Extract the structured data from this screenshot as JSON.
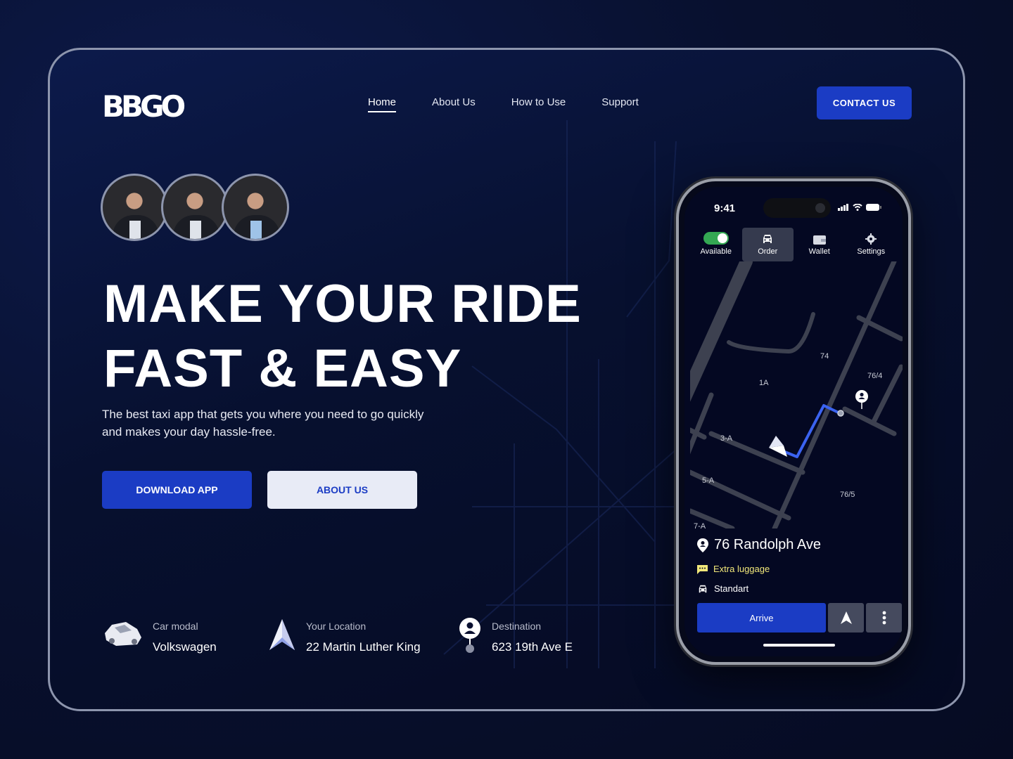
{
  "brand": {
    "logo": "BBGO"
  },
  "nav": {
    "items": [
      {
        "label": "Home",
        "active": true
      },
      {
        "label": "About Us",
        "active": false
      },
      {
        "label": "How to Use",
        "active": false
      },
      {
        "label": "Support",
        "active": false
      }
    ],
    "contact_label": "CONTACT US"
  },
  "hero": {
    "headline_line1": "MAKE YOUR RIDE",
    "headline_line2": "FAST & EASY",
    "subtitle": "The best taxi app that gets you where you need to go quickly and makes your day hassle-free.",
    "download_label": "DOWNLOAD APP",
    "about_label": "ABOUT US",
    "avatars": [
      "driver-woman",
      "driver-man-1",
      "driver-man-2"
    ]
  },
  "info": [
    {
      "icon": "car-icon",
      "label": "Car modal",
      "value": "Volkswagen"
    },
    {
      "icon": "navigation-arrow-icon",
      "label": "Your Location",
      "value": "22 Martin Luther King"
    },
    {
      "icon": "destination-pin-icon",
      "label": "Destination",
      "value": "623 19th Ave E"
    }
  ],
  "phone": {
    "time": "9:41",
    "tabs": [
      {
        "label": "Available",
        "icon": "toggle-on",
        "active": false
      },
      {
        "label": "Order",
        "icon": "car-icon",
        "active": true
      },
      {
        "label": "Wallet",
        "icon": "wallet-icon",
        "active": false
      },
      {
        "label": "Settings",
        "icon": "gear-icon",
        "active": false
      }
    ],
    "map_labels": [
      "74",
      "76/4",
      "1A",
      "3-A",
      "5-A",
      "76/5",
      "7-A"
    ],
    "address": "76 Randolph Ave",
    "note": "Extra luggage",
    "car_class": "Standart",
    "arrive_label": "Arrive"
  },
  "colors": {
    "accent": "#1b3cc4",
    "toggle": "#34a853",
    "note": "#f1e77a",
    "route": "#3b63f0"
  }
}
